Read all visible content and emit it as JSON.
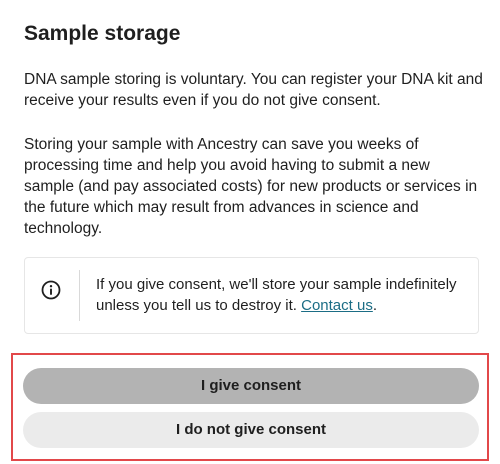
{
  "header": {
    "title": "Sample storage"
  },
  "content": {
    "paragraph_1": "DNA sample storing is voluntary. You can register your DNA kit and receive your results even if you do not give consent.",
    "paragraph_2": "Storing your sample with Ancestry can save you weeks of processing time and help you avoid having to submit a new sample (and pay associated costs) for new products or services in the future which may result from advances in science and technology."
  },
  "info_box": {
    "icon": "info-icon",
    "text": "If you give consent, we'll store your sample indefinitely unless you tell us to destroy it.",
    "link_label": "Contact us",
    "trailing": "."
  },
  "actions": {
    "give_consent_label": "I give consent",
    "decline_consent_label": "I do not give consent"
  },
  "colors": {
    "highlight_border": "#e2484a",
    "primary_button": "#b3b3b3",
    "secondary_button": "#ebebeb",
    "link": "#1b6d85"
  }
}
